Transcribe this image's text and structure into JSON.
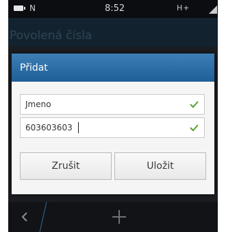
{
  "status_bar": {
    "network": "N",
    "time": "8:52",
    "signal": "H+"
  },
  "header": {
    "title": "Povolená čísla"
  },
  "dialog": {
    "title": "Přidat",
    "name_value": "Jmeno",
    "number_value": "603603603",
    "cancel_label": "Zrušit",
    "save_label": "Uložit"
  },
  "toolbar": {
    "back_icon": "chevron-left-icon",
    "add_icon": "plus-icon"
  },
  "colors": {
    "accent": "#2a6aa5",
    "check": "#5a9f35"
  }
}
